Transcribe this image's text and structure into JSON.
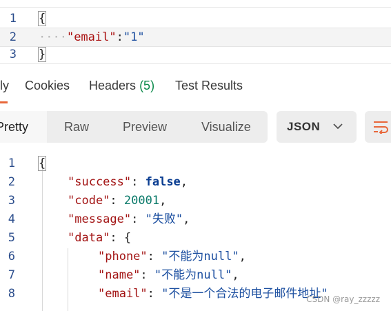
{
  "request": {
    "line_numbers": [
      "1",
      "2",
      "3"
    ],
    "lines": [
      {
        "open": "{"
      },
      {
        "indent": "····",
        "key": "\"email\"",
        "colon": ":",
        "value": "\"1\""
      },
      {
        "close": "}"
      }
    ]
  },
  "response_tabs": {
    "body_partial": "ly",
    "cookies": "Cookies",
    "headers": "Headers",
    "headers_count": "(5)",
    "test_results": "Test Results"
  },
  "views": {
    "pretty": "Pretty",
    "raw": "Raw",
    "preview": "Preview",
    "visualize": "Visualize",
    "format": "JSON"
  },
  "response": {
    "line_numbers": [
      "1",
      "2",
      "3",
      "4",
      "5",
      "6",
      "7",
      "8"
    ],
    "l1": {
      "open": "{"
    },
    "l2": {
      "key": "\"success\"",
      "colon": ": ",
      "value": "false",
      "comma": ","
    },
    "l3": {
      "key": "\"code\"",
      "colon": ": ",
      "value": "20001",
      "comma": ","
    },
    "l4": {
      "key": "\"message\"",
      "colon": ": ",
      "value": "\"失败\"",
      "comma": ","
    },
    "l5": {
      "key": "\"data\"",
      "colon": ": ",
      "open": "{"
    },
    "l6": {
      "key": "\"phone\"",
      "colon": ": ",
      "value": "\"不能为null\"",
      "comma": ","
    },
    "l7": {
      "key": "\"name\"",
      "colon": ": ",
      "value": "\"不能为null\"",
      "comma": ","
    },
    "l8": {
      "key": "\"email\"",
      "colon": ": ",
      "value": "\"不是一个合法的电子邮件地址\""
    }
  },
  "watermark": "CSDN @ray_zzzzz",
  "colors": {
    "accent": "#e8673a",
    "count": "#0a8a4a",
    "key": "#a31515",
    "string": "#1c4fa0",
    "number": "#0b7a6a"
  }
}
